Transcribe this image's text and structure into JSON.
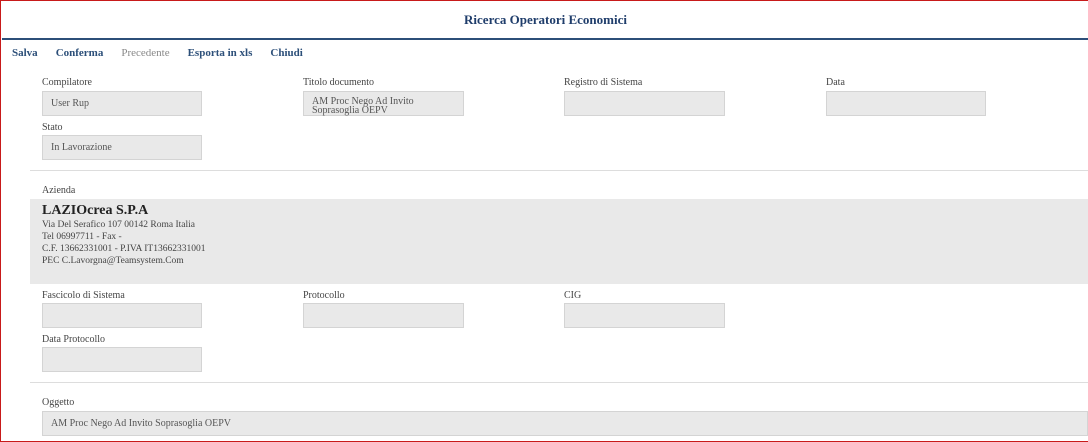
{
  "window": {
    "title": "Ricerca Operatori Economici"
  },
  "toolbar": {
    "salva": "Salva",
    "conferma": "Conferma",
    "precedente": "Precedente",
    "esporta": "Esporta in xls",
    "chiudi": "Chiudi"
  },
  "header": {
    "compilatore": {
      "label": "Compilatore",
      "value": "User Rup"
    },
    "titolo": {
      "label": "Titolo documento",
      "value": "AM Proc Nego Ad Invito Soprasoglia OEPV"
    },
    "registro": {
      "label": "Registro di Sistema",
      "value": ""
    },
    "data": {
      "label": "Data",
      "value": ""
    },
    "stato": {
      "label": "Stato",
      "value": "In Lavorazione"
    }
  },
  "azienda": {
    "label": "Azienda",
    "name": "LAZIOcrea S.P.A",
    "address": "Via Del Serafico 107 00142 Roma Italia",
    "phone": "Tel 06997711 - Fax -",
    "tax": "C.F. 13662331001 - P.IVA IT13662331001",
    "pec": "PEC C.Lavorgna@Teamsystem.Com"
  },
  "protocol": {
    "fascicolo": {
      "label": "Fascicolo di Sistema",
      "value": ""
    },
    "protocollo": {
      "label": "Protocollo",
      "value": ""
    },
    "cig": {
      "label": "CIG",
      "value": ""
    },
    "data_protocollo": {
      "label": "Data Protocollo",
      "value": ""
    }
  },
  "oggetto": {
    "label": "Oggetto",
    "value": "AM Proc Nego Ad Invito Soprasoglia OEPV"
  }
}
